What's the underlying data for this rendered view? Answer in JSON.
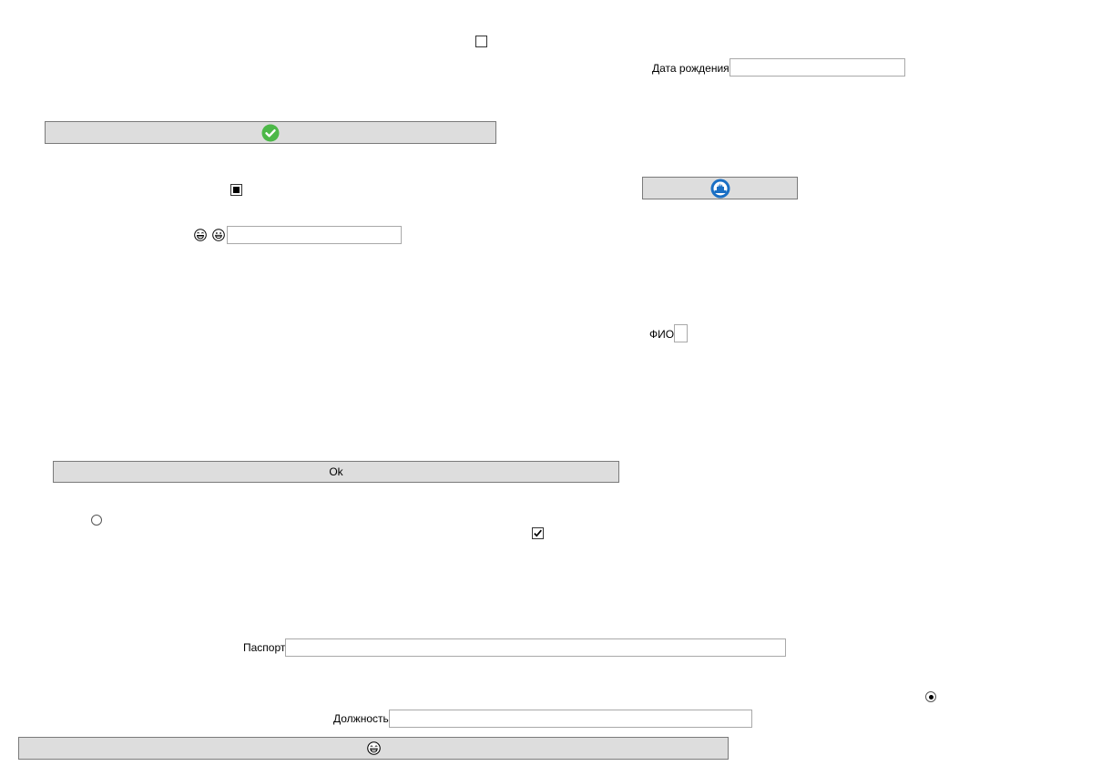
{
  "fields": {
    "birth_date": {
      "label": "Дата рождения",
      "value": ""
    },
    "full_name": {
      "label": "ФИО",
      "value": ""
    },
    "passport": {
      "label": "Паспорт",
      "value": ""
    },
    "position": {
      "label": "Должность",
      "value": ""
    },
    "emoji_field": {
      "value": ""
    }
  },
  "buttons": {
    "ok_label": "Ok",
    "check_icon": "check-circle-icon",
    "blue_icon": "blue-round-icon",
    "emoji_icon": "laughing-face-icon"
  },
  "checkboxes": {
    "top": {
      "state": "unchecked"
    },
    "middle": {
      "state": "indeterminate"
    },
    "lower": {
      "state": "checked"
    }
  },
  "radios": {
    "left": {
      "selected": false
    },
    "right": {
      "selected": true
    }
  },
  "colors": {
    "button_bg": "#dddddd",
    "check_green": "#4cb848",
    "blue_icon": "#1a6fc4"
  }
}
